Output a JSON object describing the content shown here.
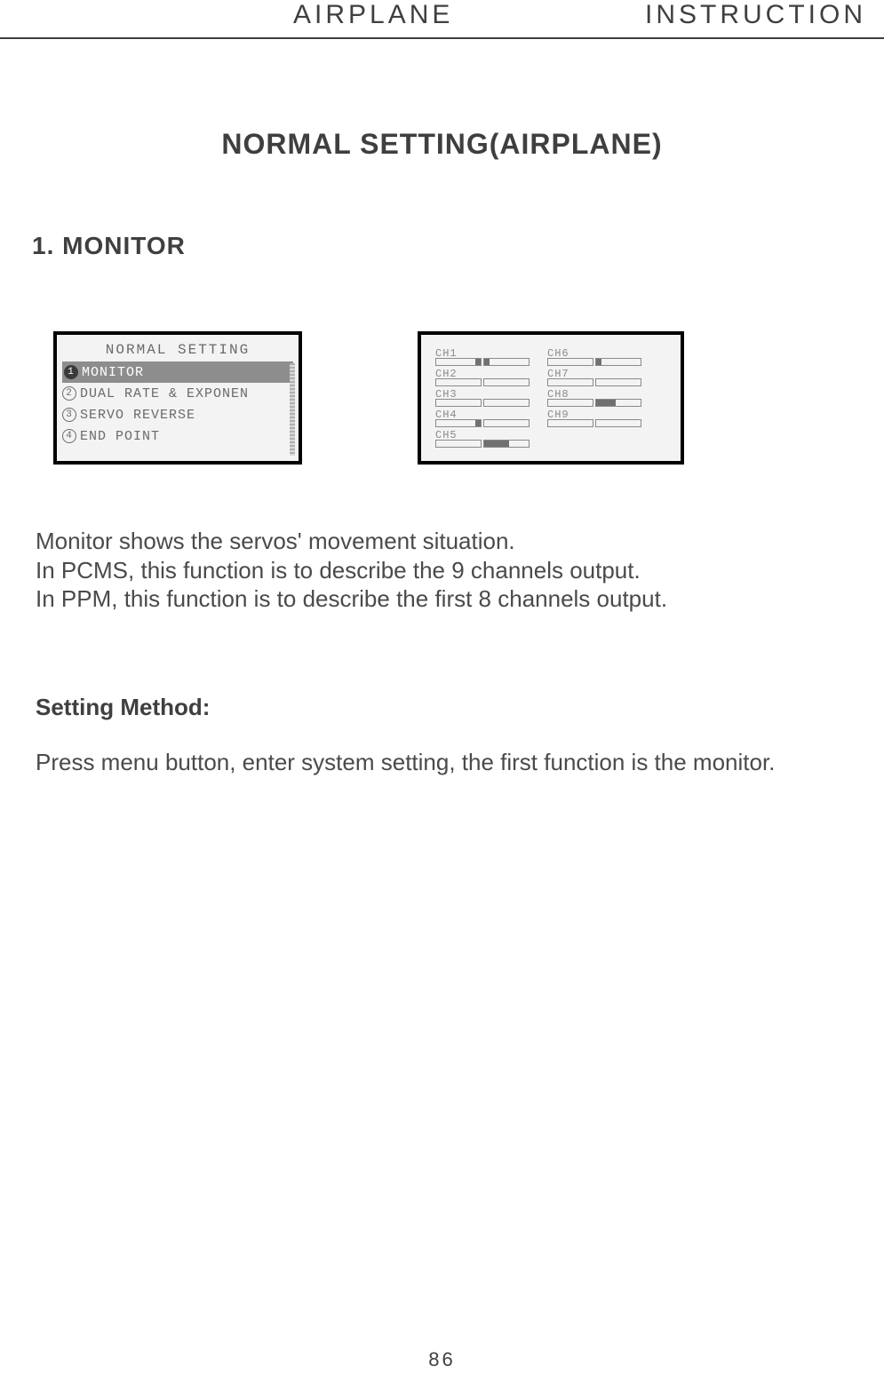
{
  "header": {
    "left": "AIRPLANE",
    "right": "INSTRUCTION"
  },
  "title": "NORMAL SETTING(AIRPLANE)",
  "section": "1. MONITOR",
  "lcd1": {
    "title": "NORMAL SETTING",
    "items": [
      {
        "num": "1",
        "label": "MONITOR",
        "selected": true
      },
      {
        "num": "2",
        "label": "DUAL RATE & EXPONEN",
        "selected": false
      },
      {
        "num": "3",
        "label": "SERVO REVERSE",
        "selected": false
      },
      {
        "num": "4",
        "label": "END POINT",
        "selected": false
      }
    ]
  },
  "lcd2": {
    "left": [
      "CH1",
      "CH2",
      "CH3",
      "CH4",
      "CH5"
    ],
    "right": [
      "CH6",
      "CH7",
      "CH8",
      "CH9"
    ]
  },
  "paragraph": {
    "l1": "Monitor shows the servos' movement situation.",
    "l2": "In PCMS, this function is to describe the 9 channels output.",
    "l3": "In PPM, this function is to describe the first 8 channels output."
  },
  "subheading": "Setting Method:",
  "paragraph2": "Press menu button, enter system setting, the first function is the monitor.",
  "pageNumber": "86"
}
